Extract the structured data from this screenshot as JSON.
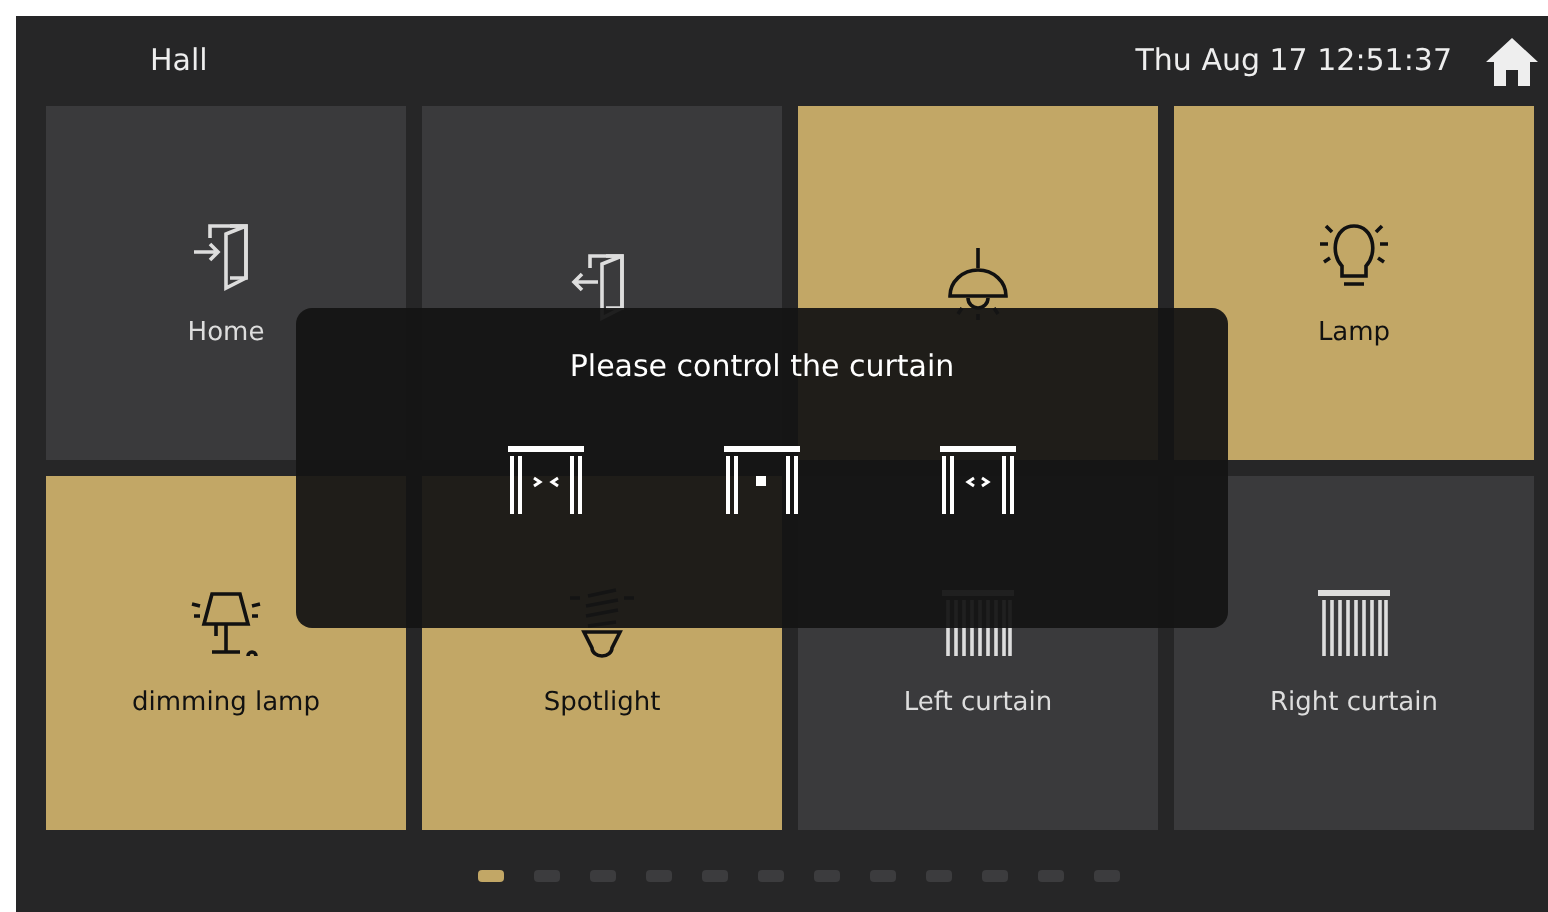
{
  "header": {
    "room": "Hall",
    "datetime": "Thu Aug 17  12:51:37"
  },
  "tiles": [
    {
      "kind": "entry",
      "label": "Home",
      "on": false
    },
    {
      "kind": "exit",
      "on": false
    },
    {
      "kind": "pendant",
      "on": true
    },
    {
      "kind": "bulb",
      "label": "Lamp",
      "on": true
    },
    {
      "kind": "table_lamp",
      "label": "dimming lamp",
      "on": true
    },
    {
      "kind": "spot",
      "label": "Spotlight",
      "on": true
    },
    {
      "kind": "curtain",
      "label": "Left curtain",
      "on": false
    },
    {
      "kind": "curtain",
      "label": "Right curtain",
      "on": false
    }
  ],
  "dialog": {
    "title": "Please control the curtain",
    "actions": [
      {
        "kind": "close"
      },
      {
        "kind": "stop"
      },
      {
        "kind": "open"
      }
    ]
  },
  "pager": [
    {
      "selected": true
    },
    {
      "selected": false
    },
    {
      "selected": false
    },
    {
      "selected": false
    },
    {
      "selected": false
    },
    {
      "selected": false
    },
    {
      "selected": false
    },
    {
      "selected": false
    },
    {
      "selected": false
    },
    {
      "selected": false
    },
    {
      "selected": false
    },
    {
      "selected": false
    }
  ]
}
